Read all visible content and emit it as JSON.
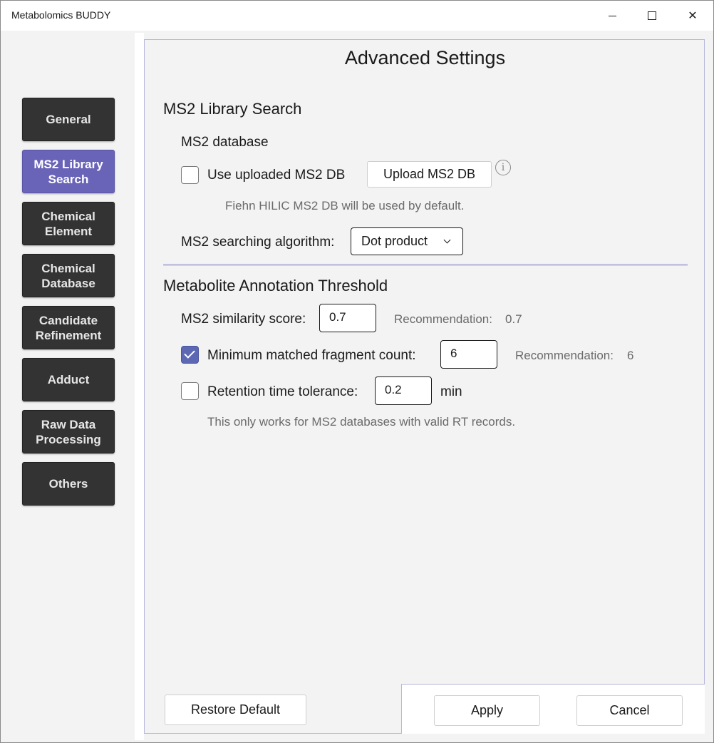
{
  "window": {
    "title": "Metabolomics BUDDY",
    "close_glyph": "✕"
  },
  "sidebar": {
    "items": [
      {
        "label": "General",
        "active": false
      },
      {
        "label": "MS2 Library\nSearch",
        "active": true
      },
      {
        "label": "Chemical\nElement",
        "active": false
      },
      {
        "label": "Chemical\nDatabase",
        "active": false
      },
      {
        "label": "Candidate\nRefinement",
        "active": false
      },
      {
        "label": "Adduct",
        "active": false
      },
      {
        "label": "Raw Data\nProcessing",
        "active": false
      },
      {
        "label": "Others",
        "active": false
      }
    ]
  },
  "colors": {
    "active_nav": "#6a64b8",
    "nav_bg": "#333333",
    "checkbox_checked": "#5d68b5"
  },
  "panel": {
    "title": "Advanced Settings",
    "ms2_library": {
      "section_title": "MS2 Library Search",
      "database_label": "MS2 database",
      "use_uploaded_label": "Use uploaded MS2 DB",
      "use_uploaded_checked": false,
      "upload_button": "Upload MS2 DB",
      "info_glyph": "i",
      "default_note": "Fiehn HILIC MS2 DB will be used by default.",
      "algorithm_label": "MS2 searching algorithm:",
      "algorithm_value": "Dot product"
    },
    "threshold": {
      "section_title": "Metabolite Annotation Threshold",
      "similarity_label": "MS2 similarity score:",
      "similarity_value": "0.7",
      "similarity_rec_label": "Recommendation:",
      "similarity_rec_value": "0.7",
      "fragment_label": "Minimum matched fragment count:",
      "fragment_checked": true,
      "fragment_value": "6",
      "fragment_rec_label": "Recommendation:",
      "fragment_rec_value": "6",
      "rt_label": "Retention time tolerance:",
      "rt_checked": false,
      "rt_value": "0.2",
      "rt_unit": "min",
      "rt_note": "This only works for MS2 databases with valid RT records."
    },
    "footer": {
      "restore_button": "Restore Default",
      "apply_button": "Apply",
      "cancel_button": "Cancel"
    }
  }
}
